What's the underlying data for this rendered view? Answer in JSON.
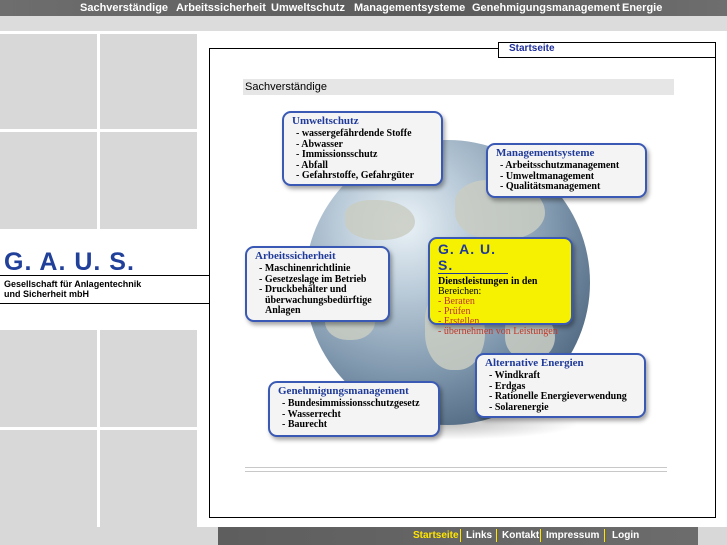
{
  "top_nav": [
    "Sachverständige",
    "Arbeitssicherheit",
    "Umweltschutz",
    "Managementsysteme",
    "Genehmigungsmanagement",
    "Energie"
  ],
  "tab_label": "Startseite",
  "section_title": "Sachverständige",
  "logo": "G. A. U. S.",
  "tagline": [
    "Gesellschaft für Anlagentechnik",
    "und Sicherheit mbH"
  ],
  "boxes": {
    "umweltschutz": {
      "title": "Umweltschutz",
      "items": [
        "- wassergefährdende Stoffe",
        "- Abwasser",
        "- Immissionsschutz",
        "- Abfall",
        "- Gefahrstoffe, Gefahrgüter"
      ]
    },
    "management": {
      "title": "Managementsysteme",
      "items": [
        "- Arbeitsschutzmanagement",
        "- Umweltmanagement",
        "- Qualitätsmanagement"
      ]
    },
    "arbeitssicherheit": {
      "title": "Arbeitssicherheit",
      "items": [
        "- Maschinenrichtlinie",
        "- Gesetzeslage im Betrieb",
        "- Druckbehälter und",
        "überwachungsbedürftige",
        "Anlagen"
      ]
    },
    "gaus": {
      "title": "G. A. U. S.",
      "subtitle": [
        "Dienstleistungen in den",
        "Bereichen:"
      ],
      "items": [
        "- Beraten",
        "- Prüfen",
        "- Erstellen",
        "- übernehmen von Leistungen"
      ]
    },
    "energie": {
      "title": "Alternative Energien",
      "items": [
        "- Windkraft",
        "- Erdgas",
        "- Rationelle Energieverwendung",
        "- Solarenergie"
      ]
    },
    "genehmigung": {
      "title": "Genehmigungsmanagement",
      "items": [
        "- Bundesimmissionsschutzgesetz",
        "- Wasserrecht",
        "- Baurecht"
      ]
    }
  },
  "footer_nav": [
    "Startseite",
    "Links",
    "Kontakt",
    "Impressum",
    "Login"
  ]
}
